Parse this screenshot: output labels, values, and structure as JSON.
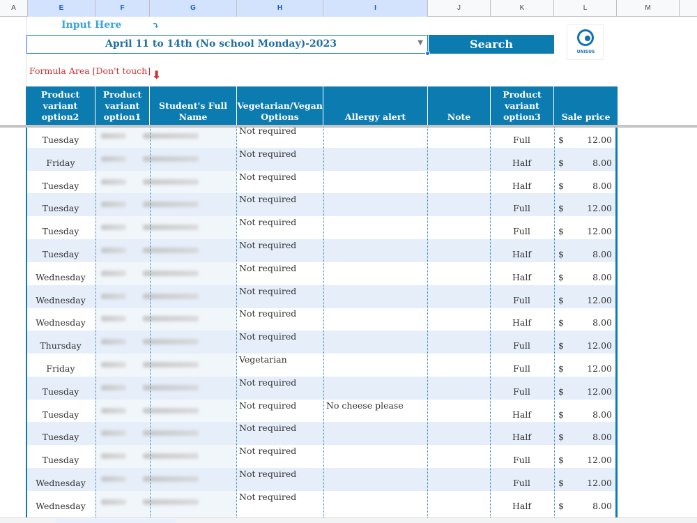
{
  "column_headers": [
    "A",
    "E",
    "F",
    "G",
    "H",
    "I",
    "J",
    "K",
    "L",
    "M"
  ],
  "input_label": "Input Here",
  "input_arrow": "⤵",
  "dropdown_value": "April 11 to 14th (No school Monday)-2023",
  "search_label": "Search",
  "logo_text": "UNISUS",
  "formula_label": "Formula Area [Don't touch]",
  "formula_arrow": "⬇",
  "table": {
    "headers": [
      "Product variant option2",
      "Product variant option1",
      "Student's Full Name",
      "Vegetarian/Vegan Options",
      "Allergy alert",
      "Note",
      "Product variant option3",
      "Sale price"
    ],
    "rows": [
      {
        "day": "Tuesday",
        "veg": "Not required",
        "allergy": "",
        "size": "Full",
        "currency": "$",
        "price": "12.00"
      },
      {
        "day": "Friday",
        "veg": "Not required",
        "allergy": "",
        "size": "Half",
        "currency": "$",
        "price": "8.00"
      },
      {
        "day": "Tuesday",
        "veg": "Not required",
        "allergy": "",
        "size": "Half",
        "currency": "$",
        "price": "8.00"
      },
      {
        "day": "Tuesday",
        "veg": "Not required",
        "allergy": "",
        "size": "Full",
        "currency": "$",
        "price": "12.00"
      },
      {
        "day": "Tuesday",
        "veg": "Not required",
        "allergy": "",
        "size": "Full",
        "currency": "$",
        "price": "12.00"
      },
      {
        "day": "Tuesday",
        "veg": "Not required",
        "allergy": "",
        "size": "Half",
        "currency": "$",
        "price": "8.00"
      },
      {
        "day": "Wednesday",
        "veg": "Not required",
        "allergy": "",
        "size": "Half",
        "currency": "$",
        "price": "8.00"
      },
      {
        "day": "Wednesday",
        "veg": "Not required",
        "allergy": "",
        "size": "Full",
        "currency": "$",
        "price": "12.00"
      },
      {
        "day": "Wednesday",
        "veg": "Not required",
        "allergy": "",
        "size": "Half",
        "currency": "$",
        "price": "8.00"
      },
      {
        "day": "Thursday",
        "veg": "Not required",
        "allergy": "",
        "size": "Full",
        "currency": "$",
        "price": "12.00"
      },
      {
        "day": "Friday",
        "veg": "Vegetarian",
        "allergy": "",
        "size": "Full",
        "currency": "$",
        "price": "12.00"
      },
      {
        "day": "Tuesday",
        "veg": "Not required",
        "allergy": "",
        "size": "Full",
        "currency": "$",
        "price": "12.00"
      },
      {
        "day": "Tuesday",
        "veg": "Not required",
        "allergy": "No cheese please",
        "size": "Half",
        "currency": "$",
        "price": "8.00"
      },
      {
        "day": "Tuesday",
        "veg": "Not required",
        "allergy": "",
        "size": "Half",
        "currency": "$",
        "price": "8.00"
      },
      {
        "day": "Tuesday",
        "veg": "Not required",
        "allergy": "",
        "size": "Full",
        "currency": "$",
        "price": "12.00"
      },
      {
        "day": "Wednesday",
        "veg": "Not required",
        "allergy": "",
        "size": "Full",
        "currency": "$",
        "price": "12.00"
      },
      {
        "day": "Wednesday",
        "veg": "Not required",
        "allergy": "",
        "size": "Half",
        "currency": "$",
        "price": "8.00"
      }
    ]
  },
  "colors": {
    "header_blue": "#0c7bb0",
    "row_alt": "#e6eefa",
    "input_label": "#3ba4dc",
    "formula_label": "#d32f2f"
  }
}
